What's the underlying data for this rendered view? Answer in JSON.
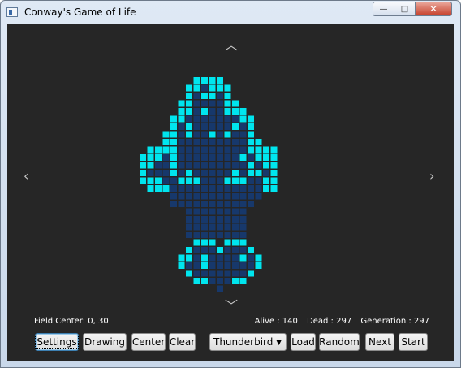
{
  "window": {
    "title": "Conway's Game of Life",
    "controls": {
      "minimize": "—",
      "maximize": "□",
      "close": "✕"
    }
  },
  "navigation": {
    "up": "︿",
    "down": "﹀",
    "left": "‹",
    "right": "›"
  },
  "status": {
    "field_center": "Field Center: 0, 30",
    "alive": "Alive : 140",
    "dead": "Dead : 297",
    "generation": "Generation : 297"
  },
  "toolbar": {
    "settings": "Settings",
    "drawing": "Drawing",
    "center": "Center",
    "clear": "Clear",
    "pattern_selected": "Thunderbird",
    "load": "Load",
    "random": "Random",
    "next": "Next",
    "start": "Start"
  },
  "colors": {
    "background": "#262626",
    "alive": "#00e5ee",
    "dead": "#17386b"
  },
  "cells": [
    ".......AAAA.......",
    "......AADAAA......",
    "......ADAADA......",
    ".....AADDDDAA.....",
    ".....AADADDAAA....",
    "....AADDDDDDDAA...",
    "....ADADDDDDADA...",
    "...AADADDADADDA...",
    "...AADDDDDDDDDAA..",
    ".AAAADDDDDDDDDAAAA.",
    "AAADADDDDDDDDADAAA",
    "AADDADDDDDDDDDADAA",
    "ADDDADADDDDDADAADA",
    "AAADDAAADDDAAADDAA",
    ".AAADDDDDDDDDDDDAA",
    "....DDDDDDDDDDDD..",
    "....DDDDDDDDDDD...",
    "......DDDDDDDD....",
    "......DDDDDDDD....",
    "......DDDDDDDD....",
    "......DDDDDDDD....",
    ".......AAA.AAA....",
    "......ADDDADDDA...",
    ".....AADADDDDADA..",
    ".....ADDADDDDDDA..",
    "......ADDDDDDDA...",
    ".......AADDDAA....",
    "..........D......."
  ]
}
